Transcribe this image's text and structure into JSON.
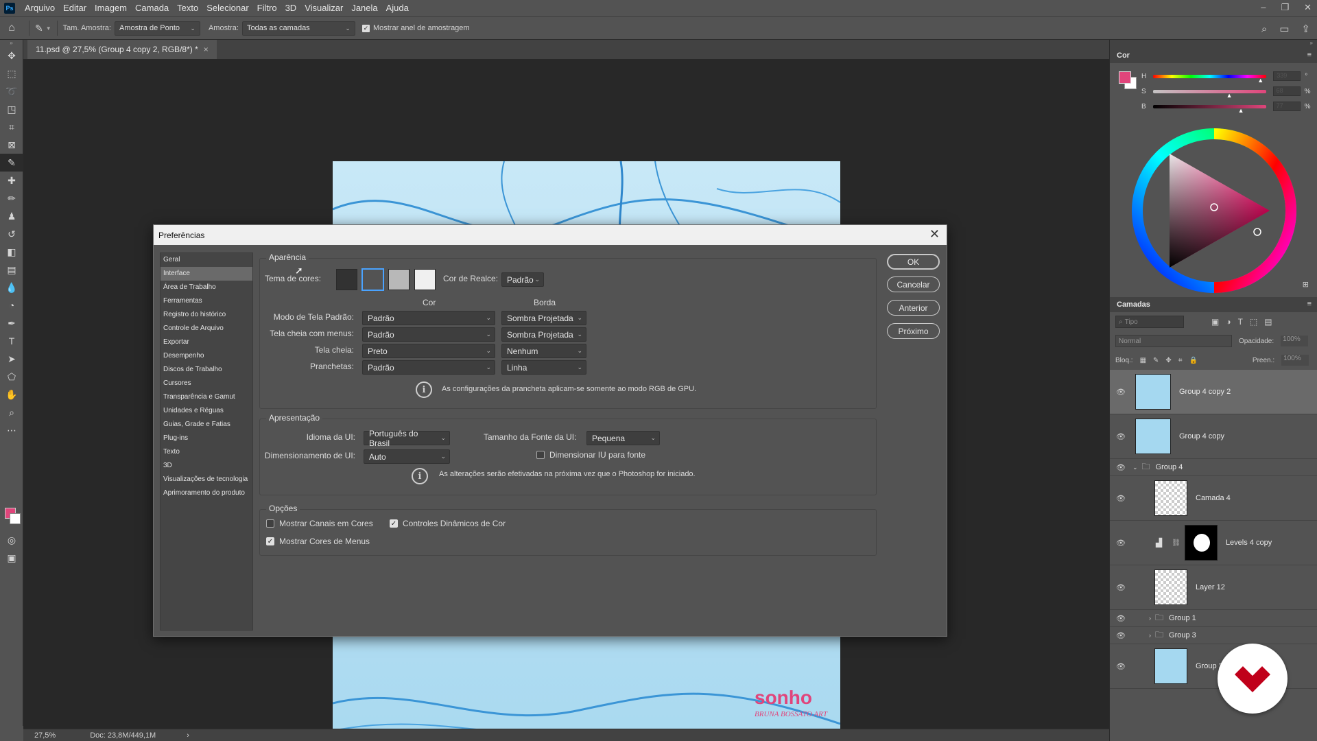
{
  "app": {
    "logo": "Ps",
    "menu": [
      "Arquivo",
      "Editar",
      "Imagem",
      "Camada",
      "Texto",
      "Selecionar",
      "Filtro",
      "3D",
      "Visualizar",
      "Janela",
      "Ajuda"
    ],
    "window_controls": [
      "–",
      "❐",
      "✕"
    ]
  },
  "options": {
    "sample_size_label": "Tam. Amostra:",
    "sample_size_value": "Amostra de Ponto",
    "sample_label": "Amostra:",
    "sample_value": "Todas as camadas",
    "show_ring_label": "Mostrar anel de amostragem",
    "show_ring_checked": true
  },
  "document": {
    "tab_title": "11.psd @ 27,5% (Group 4 copy 2, RGB/8*) *",
    "tab_close": "×",
    "artwork_text_1": "sonho",
    "artwork_text_2": "BRUNA BOSSATO ART"
  },
  "status": {
    "zoom": "27,5%",
    "doc_size": "Doc: 23,8M/449,1M",
    "arrow": "›"
  },
  "color_panel": {
    "title": "Cor",
    "h_label": "H",
    "s_label": "S",
    "b_label": "B",
    "h_value": "339",
    "s_value": "68",
    "b_value": "77",
    "h_unit": "°",
    "s_unit": "%",
    "b_unit": "%",
    "fg_color": "#e0457b"
  },
  "layers_panel": {
    "title": "Camadas",
    "search_placeholder": "Tipo",
    "blend_mode": "Normal",
    "opacity_label": "Opacidade:",
    "opacity_value": "100%",
    "lock_label": "Bloq.:",
    "fill_label": "Preen.:",
    "fill_value": "100%",
    "layers": [
      {
        "name": "Group 4 copy 2",
        "type": "image"
      },
      {
        "name": "Group 4 copy",
        "type": "image"
      },
      {
        "name": "Group 4",
        "type": "group"
      },
      {
        "name": "Camada 4",
        "type": "trans"
      },
      {
        "name": "Levels 4 copy",
        "type": "adjust"
      },
      {
        "name": "Layer 12",
        "type": "trans"
      },
      {
        "name": "Group 1",
        "type": "group"
      },
      {
        "name": "Group 3",
        "type": "group"
      },
      {
        "name": "Group 2",
        "type": "image"
      }
    ]
  },
  "dialog": {
    "title": "Preferências",
    "close": "✕",
    "nav": [
      "Geral",
      "Interface",
      "Área de Trabalho",
      "Ferramentas",
      "Registro do histórico",
      "Controle de Arquivo",
      "Exportar",
      "Desempenho",
      "Discos de Trabalho",
      "Cursores",
      "Transparência e Gamut",
      "Unidades e Réguas",
      "Guias, Grade e Fatias",
      "Plug-ins",
      "Texto",
      "3D",
      "Visualizações de tecnologia",
      "Aprimoramento do produto"
    ],
    "selected_nav": "Interface",
    "buttons": {
      "ok": "OK",
      "cancel": "Cancelar",
      "prev": "Anterior",
      "next": "Próximo"
    },
    "appearance": {
      "group": "Aparência",
      "theme_label": "Tema de cores:",
      "theme_colors": [
        "#323232",
        "#535353",
        "#b8b8b8",
        "#f0f0f0"
      ],
      "highlight_label": "Cor de Realce:",
      "highlight_value": "Padrão",
      "col_color": "Cor",
      "col_border": "Borda",
      "rows": [
        {
          "label": "Modo de Tela Padrão:",
          "color": "Padrão",
          "border": "Sombra Projetada"
        },
        {
          "label": "Tela cheia com menus:",
          "color": "Padrão",
          "border": "Sombra Projetada"
        },
        {
          "label": "Tela cheia:",
          "color": "Preto",
          "border": "Nenhum"
        },
        {
          "label": "Pranchetas:",
          "color": "Padrão",
          "border": "Linha"
        }
      ],
      "info": "As configurações da prancheta aplicam-se somente ao modo RGB de GPU."
    },
    "presentation": {
      "group": "Apresentação",
      "lang_label": "Idioma da UI:",
      "lang_value": "Português do Brasil",
      "font_label": "Tamanho da Fonte da UI:",
      "font_value": "Pequena",
      "scale_label": "Dimensionamento de UI:",
      "scale_value": "Auto",
      "scale_font_label": "Dimensionar IU para fonte",
      "info": "As alterações serão efetivadas na próxima vez que o Photoshop for iniciado."
    },
    "options": {
      "group": "Opções",
      "show_channels": "Mostrar Canais em Cores",
      "dynamic_sliders": "Controles Dinâmicos de Cor",
      "menu_colors": "Mostrar Cores de Menus"
    }
  }
}
